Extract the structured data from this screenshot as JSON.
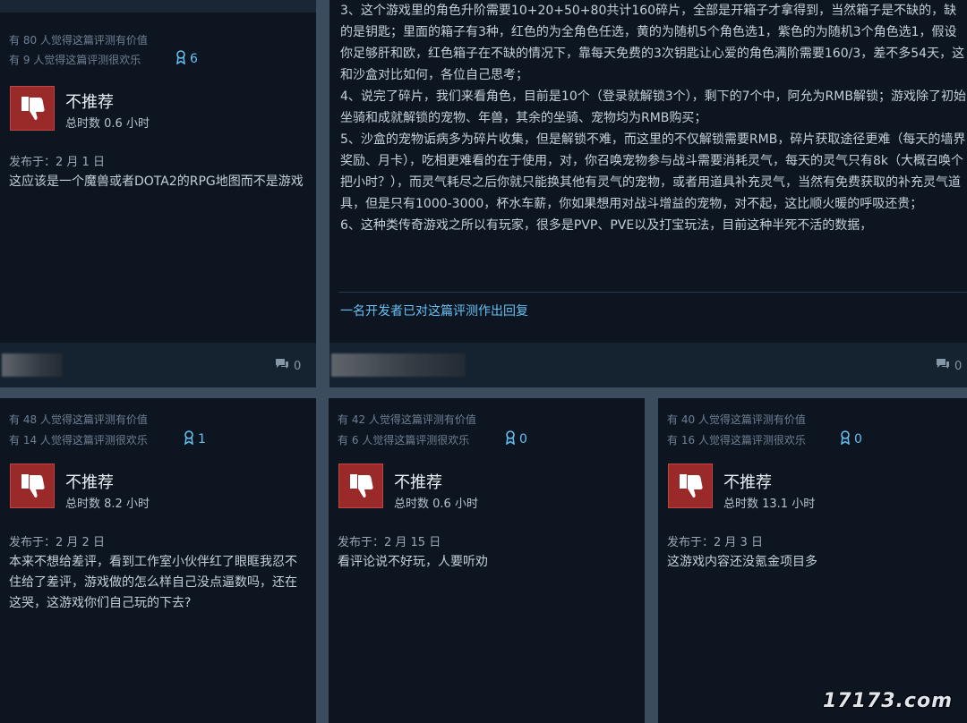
{
  "top_left_card": {
    "helpful": "有 80 人觉得这篇评测有价值",
    "funny": "有 9 人觉得这篇评测很欢乐",
    "awards": "6",
    "verdict": "不推荐",
    "hours": "总时数 0.6 小时",
    "posted": "发布于：2 月 1 日",
    "text": "这应该是一个魔兽或者DOTA2的RPG地图而不是游戏",
    "comments": "0"
  },
  "top_right_card": {
    "paragraphs": [
      "3、这个游戏里的角色升阶需要10+20+50+80共计160碎片，全部是开箱子才拿得到，当然箱子是不缺的，缺的是钥匙；里面的箱子有3种，红色的为全角色任选，黄的为随机5个角色选1，紫色的为随机3个角色选1，假设你足够肝和欧，红色箱子在不缺的情况下，靠每天免费的3次钥匙让心爱的角色满阶需要160/3，差不多54天，这和沙盒对比如何，各位自己思考；",
      "4、说完了碎片，我们来看角色，目前是10个（登录就解锁3个），剩下的7个中，阿允为RMB解锁；游戏除了初始坐骑和成就解锁的宠物、年兽，其余的坐骑、宠物均为RMB购买；",
      "5、沙盒的宠物诟病多为碎片收集，但是解锁不难，而这里的不仅解锁需要RMB，碎片获取途径更难（每天的墙界奖励、月卡），吃相更难看的在于使用，对，你召唤宠物参与战斗需要消耗灵气，每天的灵气只有8k（大概召唤个把小时？），而灵气耗尽之后你就只能换其他有灵气的宠物，或者用道具补充灵气，当然有免费获取的补充灵气道具，但是只有1000-3000，杯水车薪，你如果想用对战斗增益的宠物，对不起，这比顺火暖的呼吸还贵；",
      "6、这种类传奇游戏之所以有玩家，很多是PVP、PVE以及打宝玩法，目前这种半死不活的数据，"
    ],
    "dev_reply": "一名开发者已对这篇评测作出回复",
    "comments": "0"
  },
  "bottom_cards": [
    {
      "helpful": "有 48 人觉得这篇评测有价值",
      "funny": "有 14 人觉得这篇评测很欢乐",
      "awards": "1",
      "verdict": "不推荐",
      "hours": "总时数 8.2 小时",
      "posted": "发布于：2 月 2 日",
      "text": "本来不想给差评，看到工作室小伙伴红了眼眶我忍不住给了差评，游戏做的怎么样自己没点逼数吗，还在这哭，这游戏你们自己玩的下去?"
    },
    {
      "helpful": "有 42 人觉得这篇评测有价值",
      "funny": "有 6 人觉得这篇评测很欢乐",
      "awards": "0",
      "verdict": "不推荐",
      "hours": "总时数 0.6 小时",
      "posted": "发布于：2 月 15 日",
      "text": "看评论说不好玩，人要听劝"
    },
    {
      "helpful": "有 40 人觉得这篇评测有价值",
      "funny": "有 16 人觉得这篇评测很欢乐",
      "awards": "0",
      "verdict": "不推荐",
      "hours": "总时数 13.1 小时",
      "posted": "发布于：2 月 3 日",
      "text": "这游戏内容还没氪金项目多"
    }
  ],
  "watermark": "17173.com",
  "colors": {
    "background": "#3a4c5e",
    "card": "#0d1520",
    "thumb_red": "#9a2a2a",
    "award_blue": "#66c0f4",
    "link_blue": "#66c0f4"
  }
}
